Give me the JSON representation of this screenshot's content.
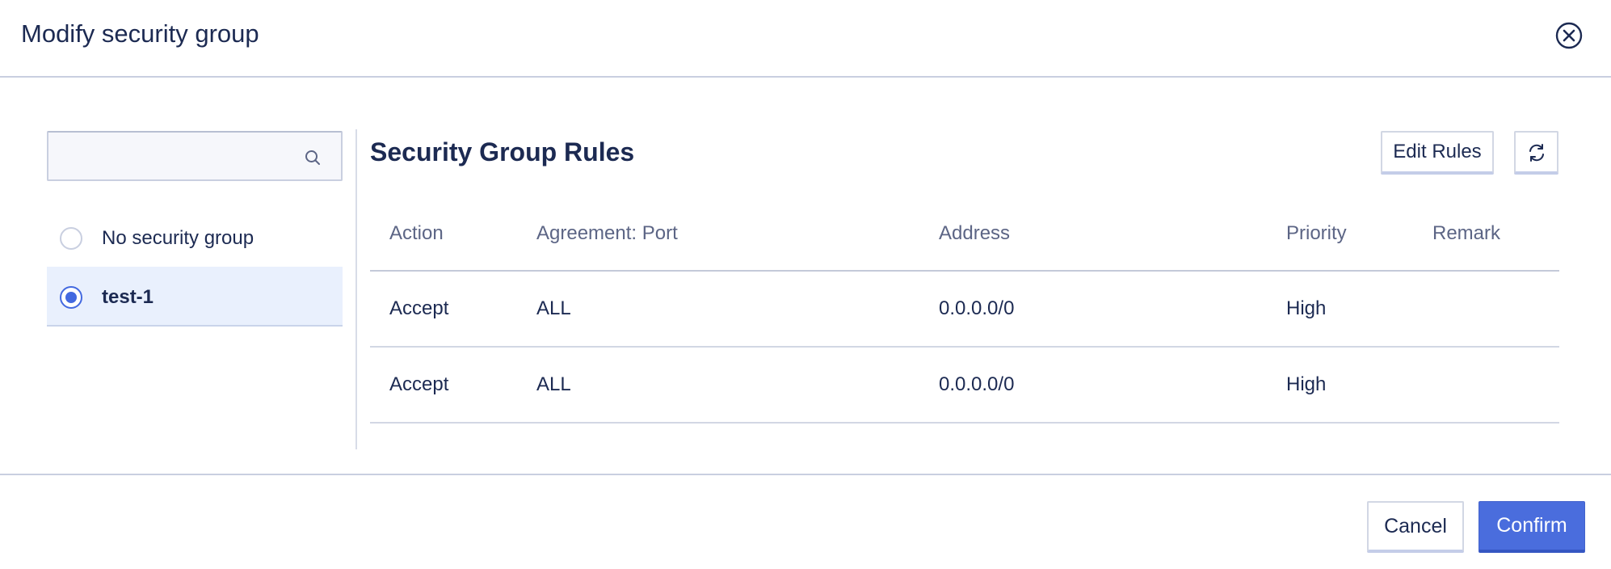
{
  "dialog": {
    "title": "Modify security group",
    "close_icon": "close-circle-icon"
  },
  "search": {
    "value": "",
    "placeholder": "",
    "icon": "search-icon"
  },
  "security_groups": [
    {
      "label": "No security group",
      "selected": false
    },
    {
      "label": "test-1",
      "selected": true
    }
  ],
  "rules_panel": {
    "title": "Security Group Rules",
    "edit_rules_label": "Edit Rules",
    "refresh_icon": "refresh-icon",
    "columns": [
      "Action",
      "Agreement: Port",
      "Address",
      "Priority",
      "Remark"
    ],
    "rows": [
      {
        "action": "Accept",
        "port": "ALL",
        "address": "0.0.0.0/0",
        "priority": "High",
        "remark": ""
      },
      {
        "action": "Accept",
        "port": "ALL",
        "address": "0.0.0.0/0",
        "priority": "High",
        "remark": ""
      }
    ]
  },
  "footer": {
    "cancel_label": "Cancel",
    "confirm_label": "Confirm"
  },
  "colors": {
    "primary": "#4a6ddd",
    "text": "#1c2a52",
    "selected_bg": "#e9f0fd",
    "border": "#c9cfe0"
  }
}
